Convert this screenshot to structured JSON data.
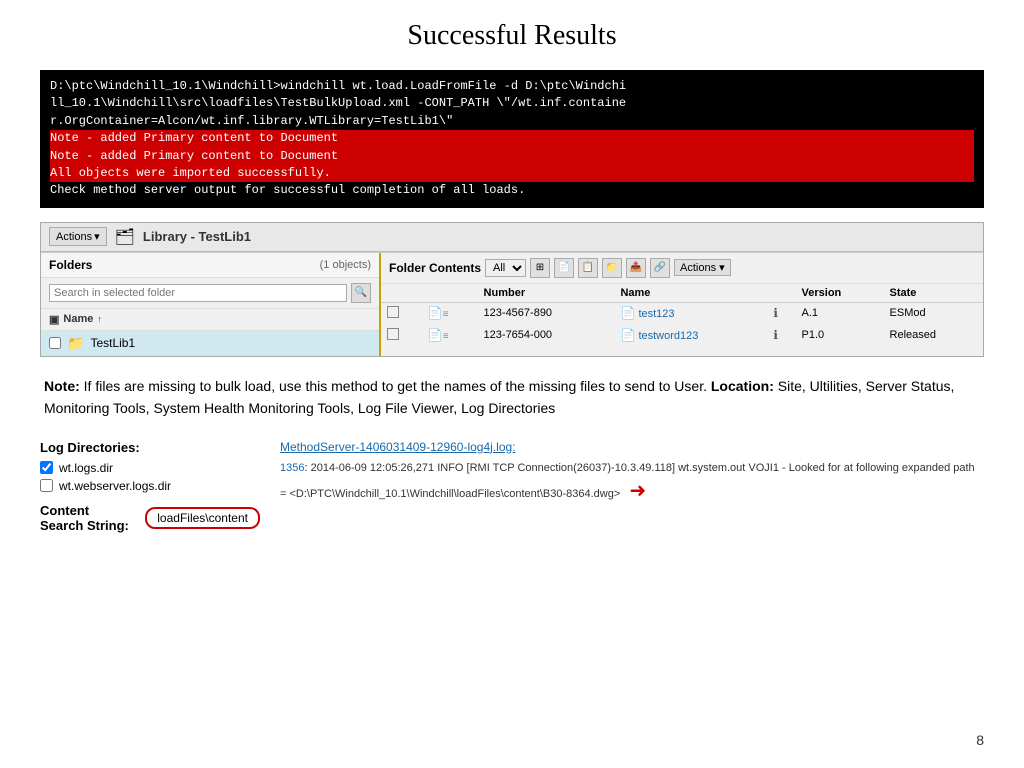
{
  "title": "Successful Results",
  "terminal": {
    "lines": [
      "D:\\ptc\\Windchill_10.1\\Windchill>windchill wt.load.LoadFromFile -d D:\\ptc\\Windchi",
      "ll_10.1\\Windchill\\src\\loadfiles\\TestBulkUpload.xml -CONT_PATH \\\"/wt.inf.containe",
      "r.OrgContainer=Alcon/wt.inf.library.WTLibrary=TestLib1\\\""
    ],
    "highlighted": [
      "Note - added Primary content to Document",
      "Note - added Primary content to Document",
      "All objects were imported successfully."
    ],
    "footer": "Check method server output for successful completion of all loads."
  },
  "windchill": {
    "toolbar": {
      "actions_label": "Actions",
      "library_prefix": "Library - ",
      "library_name": "TestLib1"
    },
    "left_pane": {
      "title": "Folders",
      "count": "(1 objects)",
      "search_placeholder": "Search in selected folder",
      "col_name": "Name",
      "sort_indicator": "↑",
      "folder_name": "TestLib1"
    },
    "right_pane": {
      "title": "Folder Contents",
      "filter_options": [
        "All"
      ],
      "filter_selected": "All",
      "actions_label": "Actions",
      "columns": [
        "",
        "",
        "Number",
        "Name",
        "",
        "Version",
        "State"
      ],
      "rows": [
        {
          "number": "123-4567-890",
          "name": "test123",
          "version": "A.1",
          "state": "ESMod"
        },
        {
          "number": "123-7654-000",
          "name": "testword123",
          "version": "P1.0",
          "state": "Released"
        }
      ]
    }
  },
  "note": {
    "bold_prefix": "Note:",
    "text1": " If files are missing to bulk load, use this method to get the names of the missing files to send to User. ",
    "location_bold": "Location:",
    "text2": " Site, Ultilities, Server Status, Monitoring Tools, System Health Monitoring Tools, Log File Viewer, Log Directories"
  },
  "log_section": {
    "title": "Log Directories:",
    "items": [
      {
        "label": "wt.logs.dir",
        "checked": true
      },
      {
        "label": "wt.webserver.logs.dir",
        "checked": false
      }
    ],
    "search_label": "Content Search String:",
    "search_value": "loadFiles\\content",
    "link_text": "MethodServer-1406031409-12960-log4j.log:",
    "log_line_num": "1356",
    "log_text": ": 2014-06-09 12:05:26,271 INFO [RMI TCP Connection(26037)-10.3.49.118] wt.system.out VOJI1 - Looked for at following expanded path = <D:\\PTC\\Windchill_10.1\\Windchill\\loadFiles\\content\\B30-8364.dwg>"
  },
  "page_number": "8"
}
